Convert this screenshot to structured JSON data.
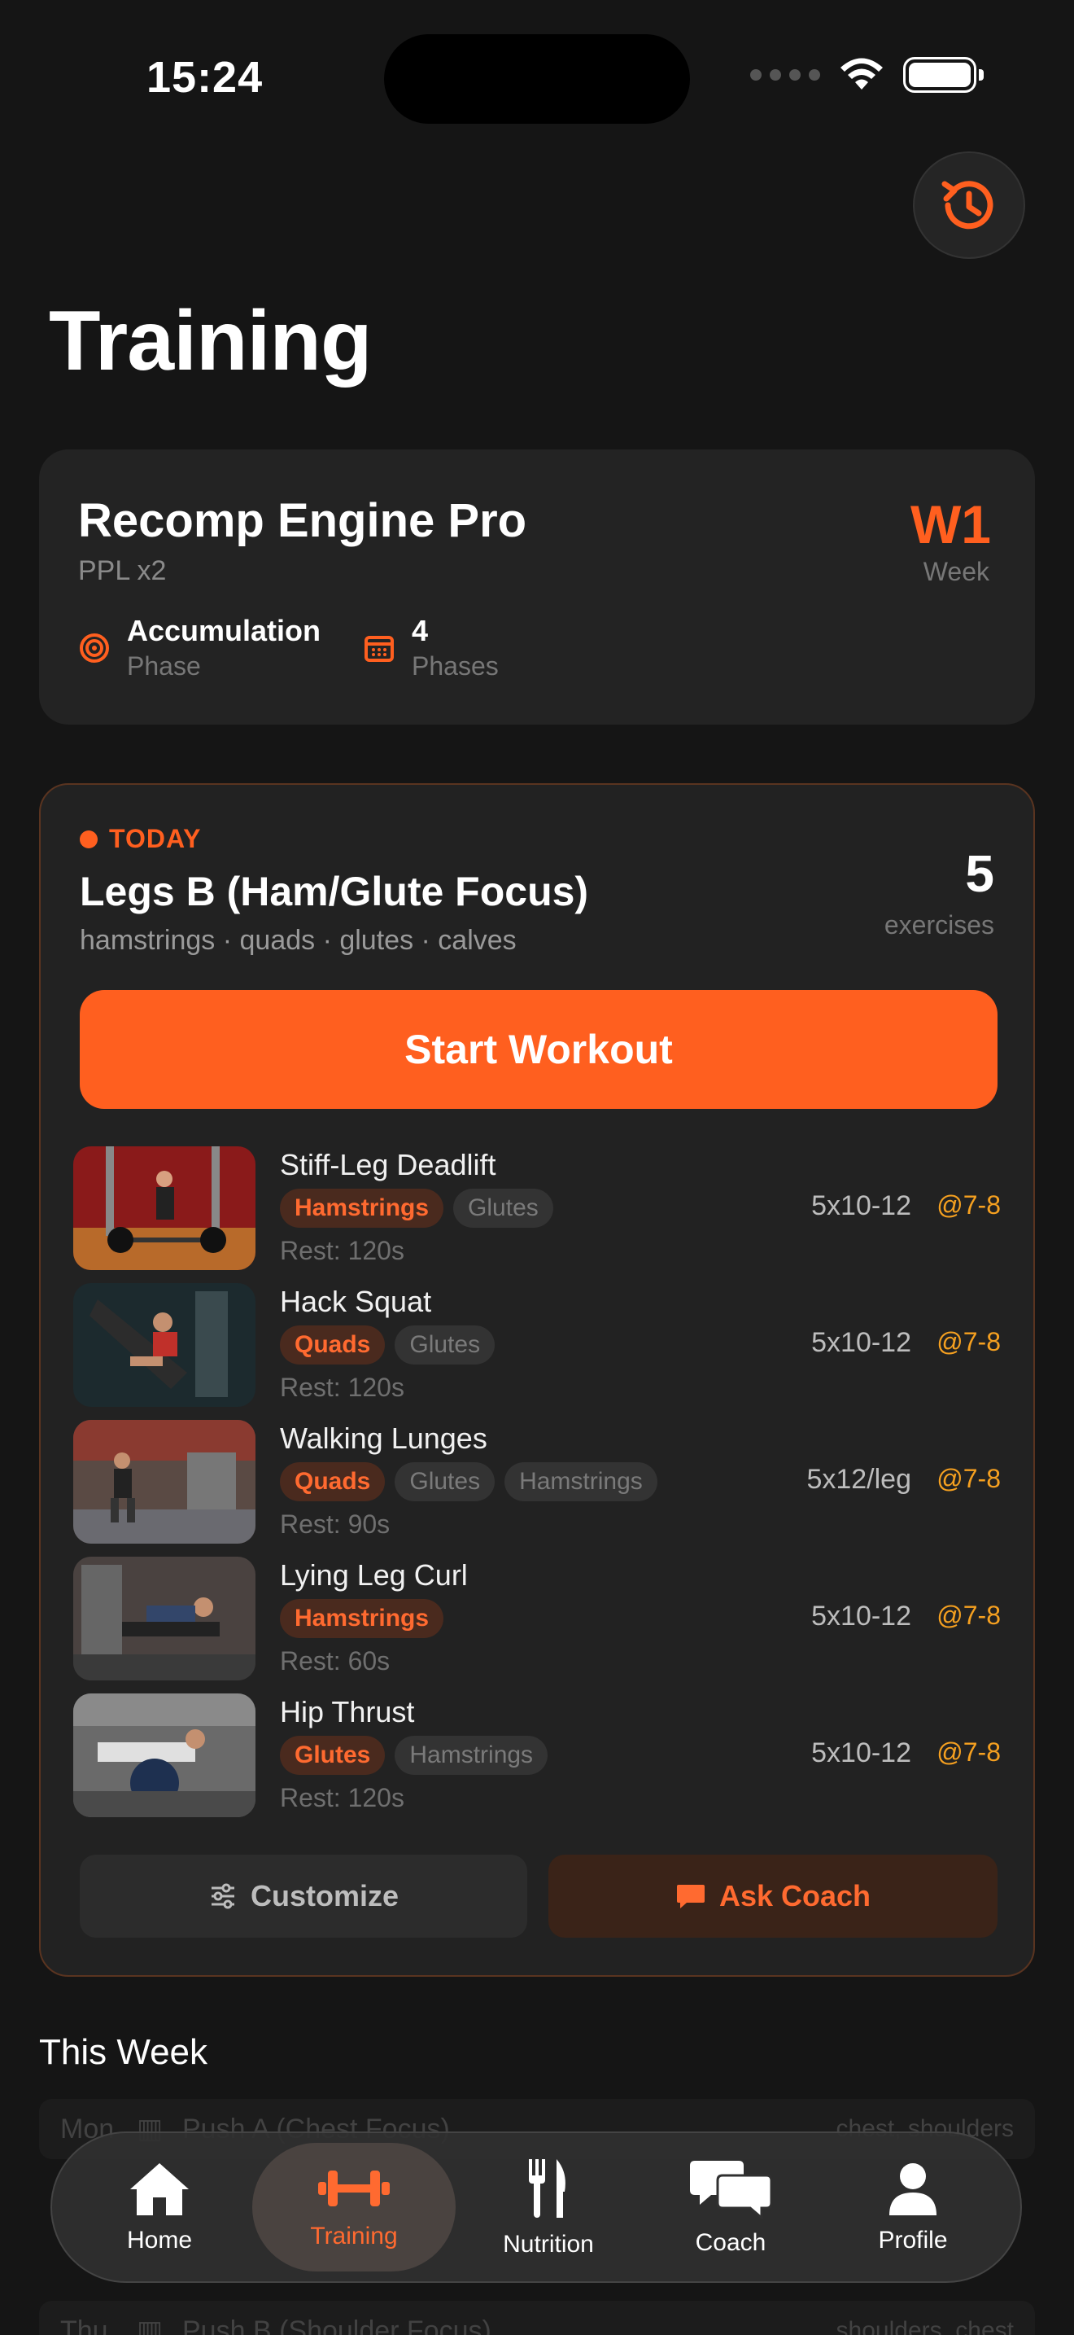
{
  "status": {
    "time": "15:24"
  },
  "colors": {
    "accent": "#ff5f1f",
    "rpe": "#f5a020",
    "background": "#151515"
  },
  "page_title": "Training",
  "program": {
    "name": "Recomp Engine Pro",
    "split": "PPL x2",
    "week_value": "W1",
    "week_label": "Week",
    "phase_value": "Accumulation",
    "phase_label": "Phase",
    "phases_value": "4",
    "phases_label": "Phases"
  },
  "today": {
    "badge": "TODAY",
    "title": "Legs B (Ham/Glute Focus)",
    "muscles": "hamstrings · quads · glutes · calves",
    "exercise_count": "5",
    "exercise_label": "exercises",
    "start_label": "Start Workout",
    "exercises": [
      {
        "name": "Stiff-Leg Deadlift",
        "tags": [
          "Hamstrings",
          "Glutes"
        ],
        "rest": "Rest: 120s",
        "sets": "5x10-12",
        "rpe": "@7-8"
      },
      {
        "name": "Hack Squat",
        "tags": [
          "Quads",
          "Glutes"
        ],
        "rest": "Rest: 120s",
        "sets": "5x10-12",
        "rpe": "@7-8"
      },
      {
        "name": "Walking Lunges",
        "tags": [
          "Quads",
          "Glutes",
          "Hamstrings"
        ],
        "rest": "Rest: 90s",
        "sets": "5x12/leg",
        "rpe": "@7-8"
      },
      {
        "name": "Lying Leg Curl",
        "tags": [
          "Hamstrings"
        ],
        "rest": "Rest: 60s",
        "sets": "5x10-12",
        "rpe": "@7-8"
      },
      {
        "name": "Hip Thrust",
        "tags": [
          "Glutes",
          "Hamstrings"
        ],
        "rest": "Rest: 120s",
        "sets": "5x10-12",
        "rpe": "@7-8"
      }
    ],
    "customize_label": "Customize",
    "coach_label": "Ask Coach"
  },
  "this_week": {
    "title": "This Week",
    "rows": [
      {
        "day": "Mon",
        "name": "Push A (Chest Focus)",
        "muscles": "chest, shoulders"
      },
      {
        "day": "Thu",
        "name": "Push B (Shoulder Focus)",
        "muscles": "shoulders, chest"
      }
    ]
  },
  "tabs": [
    {
      "label": "Home",
      "icon": "home-icon"
    },
    {
      "label": "Training",
      "icon": "dumbbell-icon"
    },
    {
      "label": "Nutrition",
      "icon": "fork-knife-icon"
    },
    {
      "label": "Coach",
      "icon": "chat-bubbles-icon"
    },
    {
      "label": "Profile",
      "icon": "person-icon"
    }
  ]
}
